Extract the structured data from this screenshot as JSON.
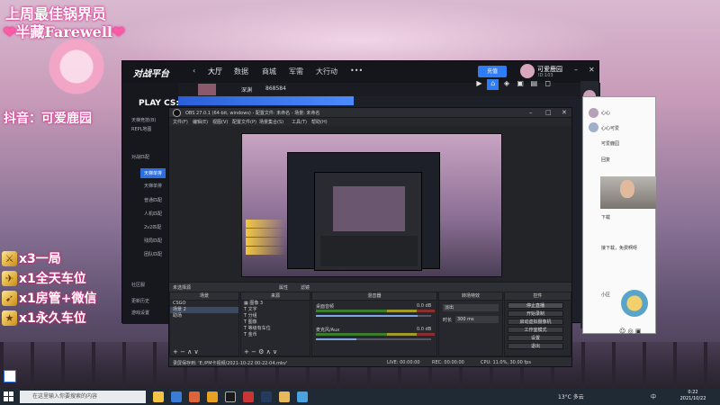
{
  "overlay": {
    "line1": "上周最佳锅界员",
    "line2_heart_l": "❤",
    "line2_name": "半藏Farewell",
    "line2_heart_r": "❤",
    "tiktok_label": "抖音：可爱鹿园",
    "rewards": [
      {
        "icon": "x3-icon",
        "text": "x3一局"
      },
      {
        "icon": "car-icon",
        "text": "x1全天车位"
      },
      {
        "icon": "mic-icon",
        "text": "x1房管+微信"
      },
      {
        "icon": "star-icon",
        "text": "x1永久车位"
      }
    ]
  },
  "platform": {
    "logo": "对战平台",
    "nav": [
      "大厅",
      "数据",
      "商城",
      "军需",
      "大行动",
      "•••"
    ],
    "button": "充值",
    "user_name": "可爱鹿园",
    "user_id": "ID:103",
    "brand": "PLAY CS:GO",
    "sidebar": [
      "天梯竞技(B)",
      "REPL地图",
      "对战匹配",
      "天梯单排",
      "天梯单排",
      "普通匹配",
      "人机匹配",
      "2v2匹配",
      "残局匹配",
      "团队匹配",
      "社区服",
      "更新历史",
      "游戏设置"
    ],
    "bar_label": "深渊",
    "bar_id": "868584",
    "icons": [
      "play-icon",
      "home-icon",
      "controller-icon",
      "box-icon",
      "chart-icon",
      "window-icon"
    ]
  },
  "obs": {
    "title": "OBS 27.0.1 (64-bit, windows) - 配置文件: 未命名 - 场景: 未命名",
    "menu": [
      "文件(F)",
      "编辑(E)",
      "视图(V)",
      "配置文件(P)",
      "场景集合(S)",
      "工具(T)",
      "帮助(H)"
    ],
    "no_source": "未选择源",
    "props": "属性",
    "filters": "滤镜",
    "docks": {
      "scenes_title": "场景",
      "scenes": [
        "CSGO",
        "场景 2",
        "助场"
      ],
      "sources_title": "来源",
      "sources": [
        "图像 3",
        "文字",
        "分组",
        "图像",
        "等级有车位",
        "金币"
      ],
      "mixer_title": "混音器",
      "mixer": [
        {
          "label": "桌面音频",
          "db": "0.0 dB"
        },
        {
          "label": "麦克风/Aux",
          "db": "0.0 dB"
        }
      ],
      "transition_title": "转场特效",
      "transition_name": "淡出",
      "transition_duration_label": "时长",
      "transition_duration": "300 ms",
      "controls_title": "控件",
      "controls": [
        "停止直播",
        "开始录制",
        "启动虚拟摄像机",
        "工作室模式",
        "设置",
        "退出"
      ]
    },
    "status": {
      "saved": "录屏保存到: 'E:/PM卡视频/2021-10-22 00-22-04.mkv'",
      "live": "LIVE: 00:00:00",
      "rec": "REC: 00:00:00",
      "cpu": "CPU: 11.0%, 30.00 fps"
    }
  },
  "chat": {
    "lines": [
      "回复",
      "可爱鹿园",
      "下载",
      "接下载，免费啊呀",
      "分享"
    ],
    "names": [
      "心心",
      "心心可爱",
      "小区",
      "鹿园"
    ]
  },
  "taskbar": {
    "search_placeholder": "在这里输入你要搜索的内容",
    "weather": "13°C 多云",
    "lang": "中",
    "time": "0:22",
    "date": "2021/10/22"
  },
  "colors": {
    "accent_blue": "#2e7df6",
    "overlay_pink": "#ff3e9e",
    "obs_bg": "#2a2b30"
  }
}
